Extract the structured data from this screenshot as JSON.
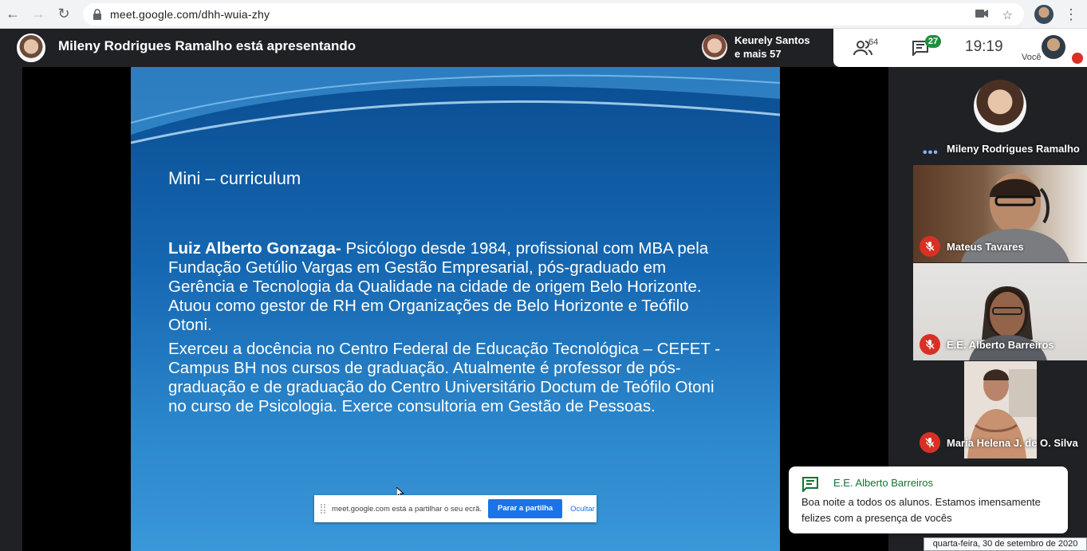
{
  "browser": {
    "url": "meet.google.com/dhh-wuia-zhy"
  },
  "meet": {
    "presenter_title": "Mileny Rodrigues Ramalho está apresentando",
    "others_line1": "Keurely Santos",
    "others_line2": "e mais 57",
    "people_count": "64",
    "chat_count": "27",
    "time": "19:19",
    "self_label": "Você"
  },
  "slide": {
    "title": "Mini – curriculum",
    "name_bold": "Luiz Alberto Gonzaga-",
    "para1_rest": " Psicólogo desde 1984, profissional com MBA pela Fundação Getúlio Vargas em Gestão Empresarial, pós-graduado em Gerência e Tecnologia da Qualidade na cidade de origem Belo Horizonte. Atuou como gestor de RH em Organizações de Belo Horizonte e Teófilo Otoni.",
    "para2": "Exerceu a docência no Centro Federal de Educação Tecnológica – CEFET - Campus BH nos cursos de graduação. Atualmente é professor de pós-graduação e de graduação do Centro Universitário Doctum de Teófilo Otoni no curso de Psicologia. Exerce consultoria em Gestão de Pessoas."
  },
  "share_bar": {
    "text": "meet.google.com está a partilhar o seu ecrã.",
    "stop_label": "Parar a partilha",
    "hide_label": "Ocultar"
  },
  "participants": [
    {
      "name": "Mileny Rodrigues Ramalho",
      "muted": false,
      "speaking": true
    },
    {
      "name": "Mateus Tavares",
      "muted": true
    },
    {
      "name": "E.E. Alberto Barreiros",
      "muted": true
    },
    {
      "name": "Maria Helena J. de O. Silva",
      "muted": true
    }
  ],
  "chat_toast": {
    "sender": "E.E. Alberto Barreiros",
    "message": "Boa noite a todos os alunos. Estamos imensamente felizes com a presença de vocês"
  },
  "taskbar_tooltip": "quarta-feira, 30 de setembro de 2020",
  "colors": {
    "accent": "#1a73e8",
    "mic_off": "#d93025",
    "chat_green": "#137333",
    "badge_green": "#1e8e3e"
  }
}
